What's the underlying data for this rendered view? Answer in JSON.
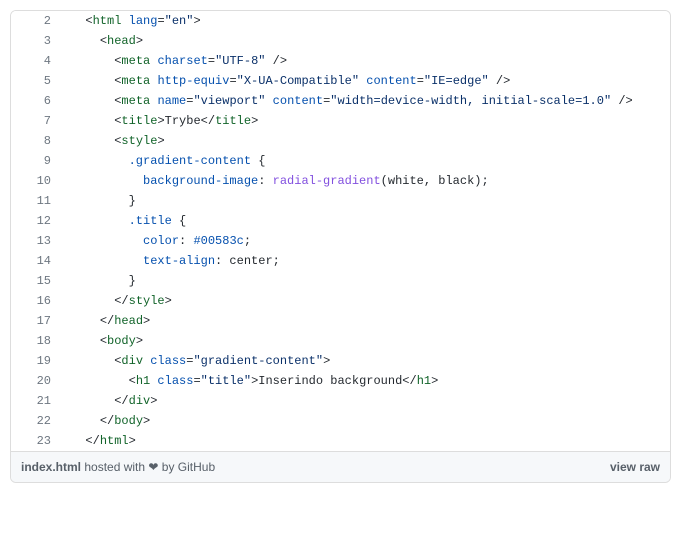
{
  "lines": [
    {
      "n": "2",
      "indent": 1,
      "tokens": [
        [
          "<",
          "pl-txt"
        ],
        [
          "html",
          "pl-ent"
        ],
        [
          " ",
          "pl-txt"
        ],
        [
          "lang",
          "pl-e"
        ],
        [
          "=",
          "pl-txt"
        ],
        [
          "\"en\"",
          "pl-s"
        ],
        [
          ">",
          "pl-txt"
        ]
      ]
    },
    {
      "n": "3",
      "indent": 2,
      "tokens": [
        [
          "<",
          "pl-txt"
        ],
        [
          "head",
          "pl-ent"
        ],
        [
          ">",
          "pl-txt"
        ]
      ]
    },
    {
      "n": "4",
      "indent": 3,
      "tokens": [
        [
          "<",
          "pl-txt"
        ],
        [
          "meta",
          "pl-ent"
        ],
        [
          " ",
          "pl-txt"
        ],
        [
          "charset",
          "pl-e"
        ],
        [
          "=",
          "pl-txt"
        ],
        [
          "\"UTF-8\"",
          "pl-s"
        ],
        [
          " />",
          "pl-txt"
        ]
      ]
    },
    {
      "n": "5",
      "indent": 3,
      "tokens": [
        [
          "<",
          "pl-txt"
        ],
        [
          "meta",
          "pl-ent"
        ],
        [
          " ",
          "pl-txt"
        ],
        [
          "http-equiv",
          "pl-e"
        ],
        [
          "=",
          "pl-txt"
        ],
        [
          "\"X-UA-Compatible\"",
          "pl-s"
        ],
        [
          " ",
          "pl-txt"
        ],
        [
          "content",
          "pl-e"
        ],
        [
          "=",
          "pl-txt"
        ],
        [
          "\"IE=edge\"",
          "pl-s"
        ],
        [
          " />",
          "pl-txt"
        ]
      ]
    },
    {
      "n": "6",
      "indent": 3,
      "tokens": [
        [
          "<",
          "pl-txt"
        ],
        [
          "meta",
          "pl-ent"
        ],
        [
          " ",
          "pl-txt"
        ],
        [
          "name",
          "pl-e"
        ],
        [
          "=",
          "pl-txt"
        ],
        [
          "\"viewport\"",
          "pl-s"
        ],
        [
          " ",
          "pl-txt"
        ],
        [
          "content",
          "pl-e"
        ],
        [
          "=",
          "pl-txt"
        ],
        [
          "\"width=device-width, initial-scale=1.0\"",
          "pl-s"
        ],
        [
          " />",
          "pl-txt"
        ]
      ]
    },
    {
      "n": "7",
      "indent": 3,
      "tokens": [
        [
          "<",
          "pl-txt"
        ],
        [
          "title",
          "pl-ent"
        ],
        [
          ">",
          "pl-txt"
        ],
        [
          "Trybe",
          "pl-txt"
        ],
        [
          "</",
          "pl-txt"
        ],
        [
          "title",
          "pl-ent"
        ],
        [
          ">",
          "pl-txt"
        ]
      ]
    },
    {
      "n": "8",
      "indent": 3,
      "tokens": [
        [
          "<",
          "pl-txt"
        ],
        [
          "style",
          "pl-ent"
        ],
        [
          ">",
          "pl-txt"
        ]
      ]
    },
    {
      "n": "9",
      "indent": 4,
      "tokens": [
        [
          ".gradient-content",
          "pl-e"
        ],
        [
          " {",
          "pl-txt"
        ]
      ]
    },
    {
      "n": "10",
      "indent": 5,
      "tokens": [
        [
          "background-image",
          "pl-c1"
        ],
        [
          ": ",
          "pl-txt"
        ],
        [
          "radial-gradient",
          "pl-v"
        ],
        [
          "(white, black);",
          "pl-txt"
        ]
      ]
    },
    {
      "n": "11",
      "indent": 4,
      "tokens": [
        [
          "}",
          "pl-txt"
        ]
      ]
    },
    {
      "n": "12",
      "indent": 4,
      "tokens": [
        [
          ".title",
          "pl-e"
        ],
        [
          " {",
          "pl-txt"
        ]
      ]
    },
    {
      "n": "13",
      "indent": 5,
      "tokens": [
        [
          "color",
          "pl-c1"
        ],
        [
          ": ",
          "pl-txt"
        ],
        [
          "#00583c",
          "pl-c1"
        ],
        [
          ";",
          "pl-txt"
        ]
      ]
    },
    {
      "n": "14",
      "indent": 5,
      "tokens": [
        [
          "text-align",
          "pl-c1"
        ],
        [
          ": center;",
          "pl-txt"
        ]
      ]
    },
    {
      "n": "15",
      "indent": 4,
      "tokens": [
        [
          "}",
          "pl-txt"
        ]
      ]
    },
    {
      "n": "16",
      "indent": 3,
      "tokens": [
        [
          "</",
          "pl-txt"
        ],
        [
          "style",
          "pl-ent"
        ],
        [
          ">",
          "pl-txt"
        ]
      ]
    },
    {
      "n": "17",
      "indent": 2,
      "tokens": [
        [
          "</",
          "pl-txt"
        ],
        [
          "head",
          "pl-ent"
        ],
        [
          ">",
          "pl-txt"
        ]
      ]
    },
    {
      "n": "18",
      "indent": 2,
      "tokens": [
        [
          "<",
          "pl-txt"
        ],
        [
          "body",
          "pl-ent"
        ],
        [
          ">",
          "pl-txt"
        ]
      ]
    },
    {
      "n": "19",
      "indent": 3,
      "tokens": [
        [
          "<",
          "pl-txt"
        ],
        [
          "div",
          "pl-ent"
        ],
        [
          " ",
          "pl-txt"
        ],
        [
          "class",
          "pl-e"
        ],
        [
          "=",
          "pl-txt"
        ],
        [
          "\"gradient-content\"",
          "pl-s"
        ],
        [
          ">",
          "pl-txt"
        ]
      ]
    },
    {
      "n": "20",
      "indent": 4,
      "tokens": [
        [
          "<",
          "pl-txt"
        ],
        [
          "h1",
          "pl-ent"
        ],
        [
          " ",
          "pl-txt"
        ],
        [
          "class",
          "pl-e"
        ],
        [
          "=",
          "pl-txt"
        ],
        [
          "\"title\"",
          "pl-s"
        ],
        [
          ">",
          "pl-txt"
        ],
        [
          "Inserindo background",
          "pl-txt"
        ],
        [
          "</",
          "pl-txt"
        ],
        [
          "h1",
          "pl-ent"
        ],
        [
          ">",
          "pl-txt"
        ]
      ]
    },
    {
      "n": "21",
      "indent": 3,
      "tokens": [
        [
          "</",
          "pl-txt"
        ],
        [
          "div",
          "pl-ent"
        ],
        [
          ">",
          "pl-txt"
        ]
      ]
    },
    {
      "n": "22",
      "indent": 2,
      "tokens": [
        [
          "</",
          "pl-txt"
        ],
        [
          "body",
          "pl-ent"
        ],
        [
          ">",
          "pl-txt"
        ]
      ]
    },
    {
      "n": "23",
      "indent": 1,
      "tokens": [
        [
          "</",
          "pl-txt"
        ],
        [
          "html",
          "pl-ent"
        ],
        [
          ">",
          "pl-txt"
        ]
      ]
    }
  ],
  "footer": {
    "filename": "index.html",
    "hosted_prefix": " hosted with ",
    "heart": "❤",
    "by": " by ",
    "host": "GitHub",
    "view_raw": "view raw"
  }
}
